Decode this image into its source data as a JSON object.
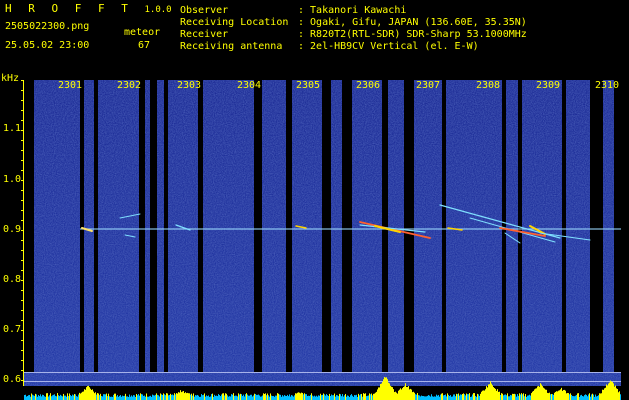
{
  "header": {
    "app_name": "H R O F F T",
    "version": "1.0.0",
    "filename": "2505022300.png",
    "timestamp": "25.05.02 23:00",
    "event_label": "meteor",
    "event_count": "67",
    "info": [
      {
        "label": "Observer",
        "value": ": Takanori Kawachi"
      },
      {
        "label": "Receiving Location",
        "value": ": Ogaki, Gifu, JAPAN (136.60E, 35.35N)"
      },
      {
        "label": "Receiver",
        "value": ": R820T2(RTL-SDR) SDR-Sharp 53.1000MHz"
      },
      {
        "label": "Receiving antenna",
        "value": ": 2el-HB9CV Vertical (el. E-W)"
      }
    ]
  },
  "axis": {
    "unit": "kHz",
    "y_ticks": [
      "1.1",
      "1.0",
      "0.9",
      "0.8",
      "0.7",
      "0.6"
    ],
    "x_ticks": [
      "2301",
      "2302",
      "2303",
      "2304",
      "2305",
      "2306",
      "2307",
      "2308",
      "2309",
      "2310"
    ]
  },
  "colors": {
    "text": "#ffff00",
    "background": "#000000",
    "spectrogram": "#1a2a8c",
    "signal_line": "#9ad9ff",
    "meteor_trace": "#ff6030",
    "bar_cyan": "#00bfff",
    "bar_yellow": "#ffff00"
  }
}
